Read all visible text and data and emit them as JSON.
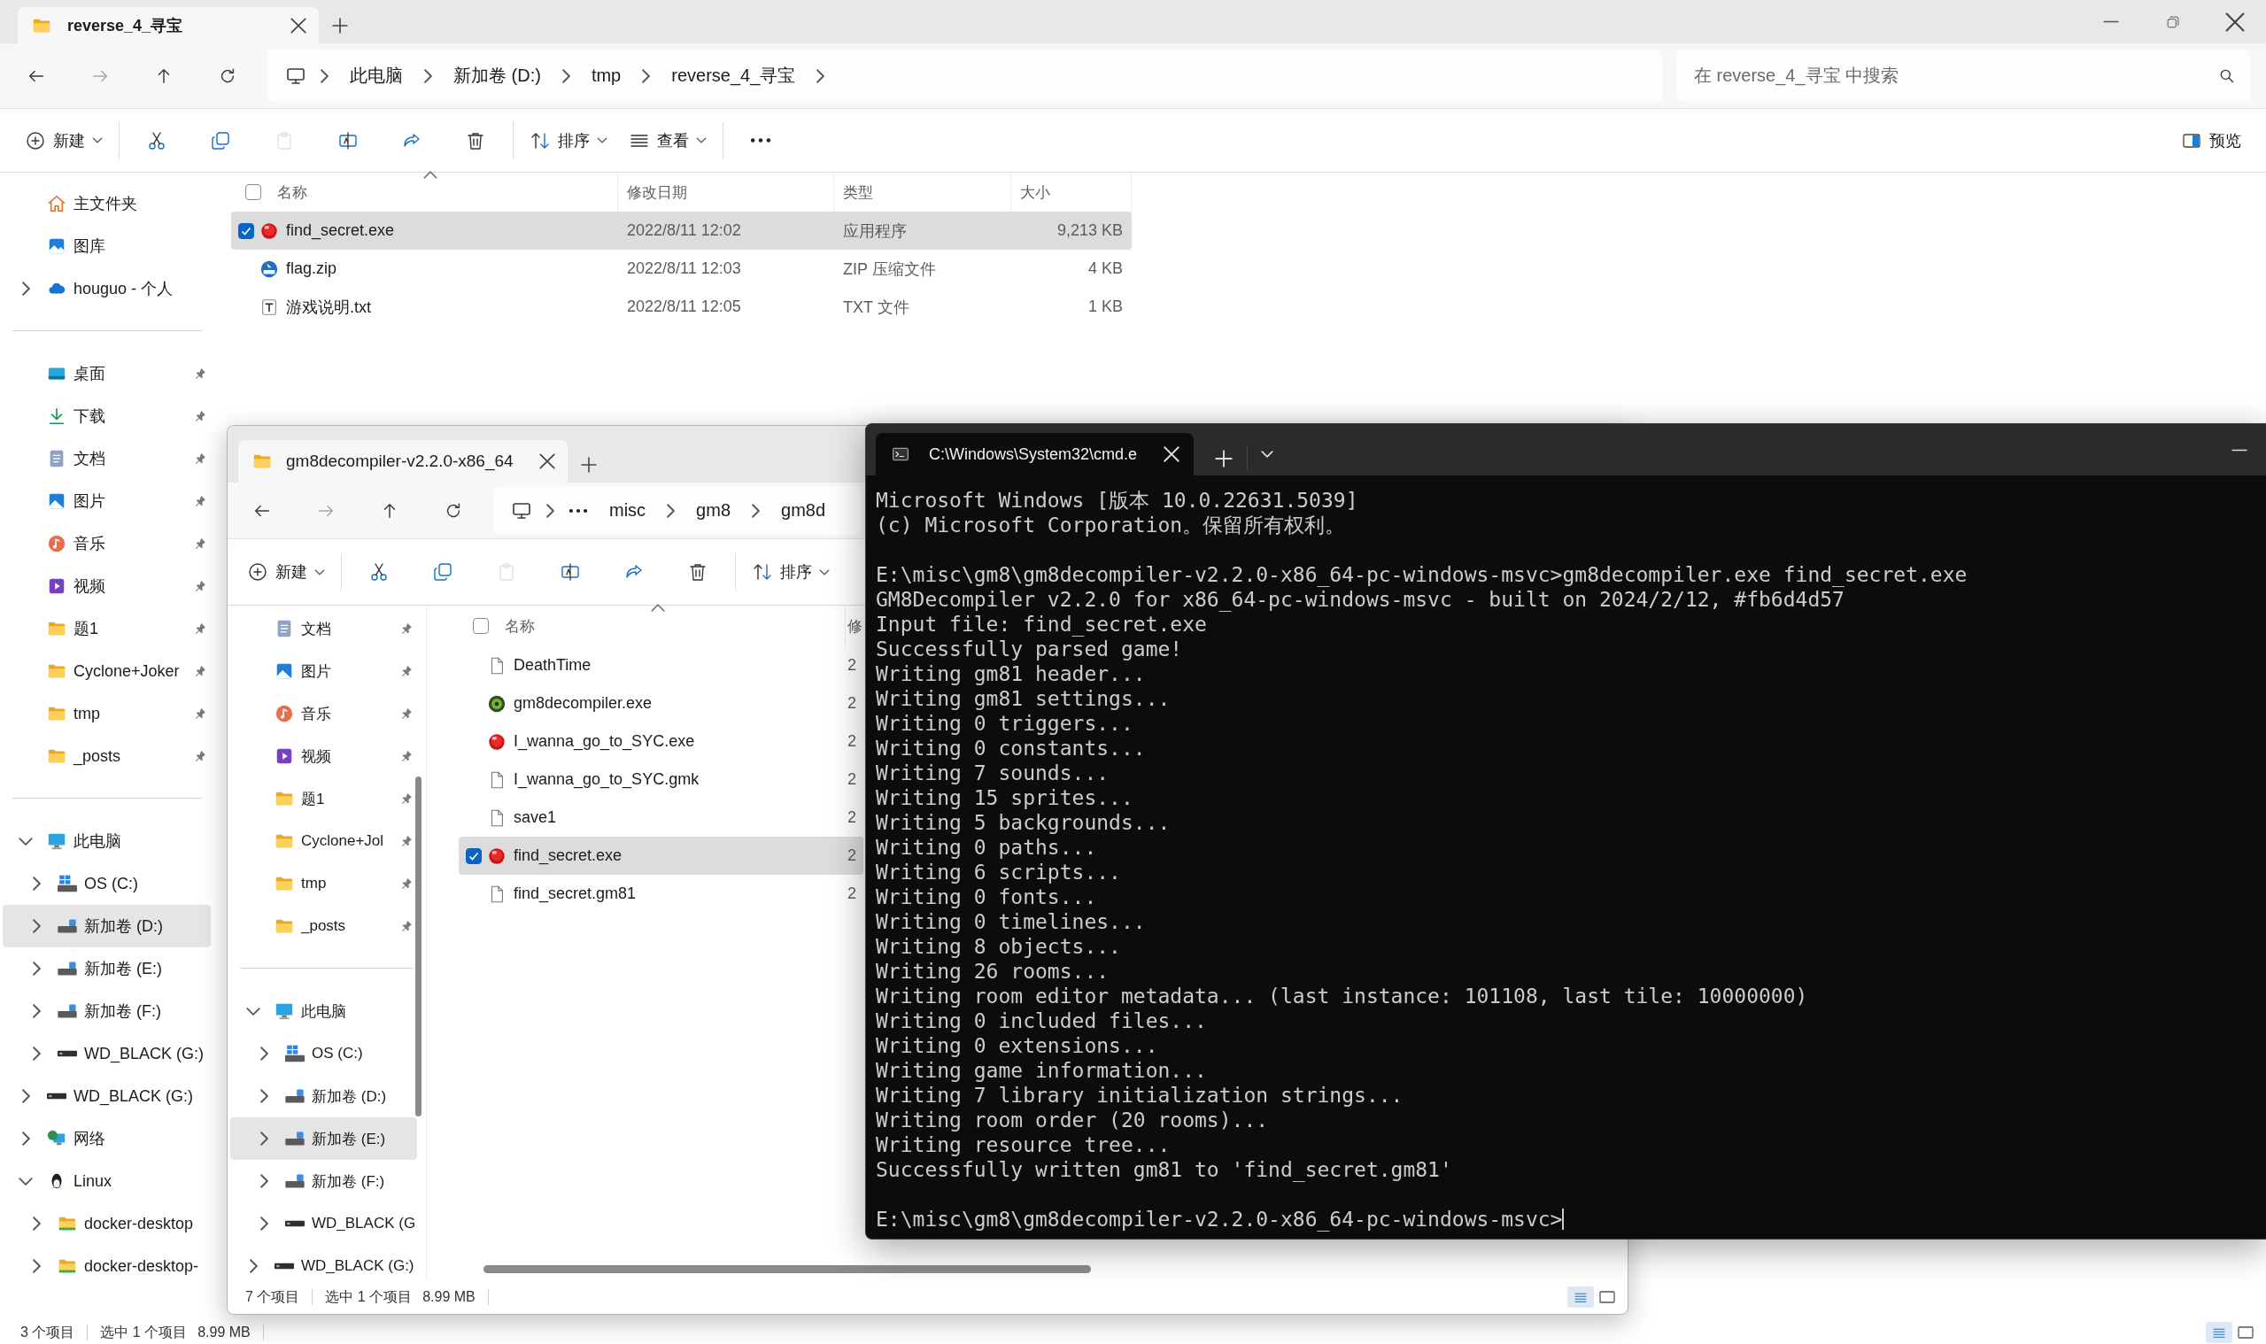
{
  "explorers": [
    {
      "tab": {
        "title": "reverse_4_寻宝"
      },
      "breadcrumb": [
        {
          "kind": "pc"
        },
        {
          "kind": "folder",
          "label": "此电脑"
        },
        {
          "kind": "folder",
          "label": "新加卷 (D:)"
        },
        {
          "kind": "folder",
          "label": "tmp"
        },
        {
          "kind": "folder",
          "label": "reverse_4_寻宝"
        }
      ],
      "search": {
        "placeholder": "在 reverse_4_寻宝 中搜索"
      },
      "toolbar": [
        [
          {
            "kind": "new",
            "label": "新建",
            "disabled": false
          }
        ],
        [
          {
            "kind": "cut",
            "disabled": false
          },
          {
            "kind": "copy",
            "disabled": false
          },
          {
            "kind": "paste",
            "disabled": true
          },
          {
            "kind": "rename",
            "disabled": false
          },
          {
            "kind": "share",
            "disabled": false
          },
          {
            "kind": "delete",
            "disabled": false
          }
        ],
        [
          {
            "kind": "sort",
            "label": "排序",
            "disabled": false
          },
          {
            "kind": "view",
            "label": "查看",
            "disabled": false
          }
        ],
        [
          {
            "kind": "more",
            "disabled": false
          }
        ]
      ],
      "preview": {
        "label": "预览"
      },
      "sidebar": [
        [
          {
            "label": "主文件夹",
            "kind": "home",
            "selected": false
          },
          {
            "label": "图库",
            "kind": "gallery",
            "selected": false
          },
          {
            "label": "houguo - 个人",
            "kind": "cloud",
            "selected": false,
            "expanded": false
          }
        ],
        [
          {
            "label": "桌面",
            "kind": "desktop",
            "selected": false,
            "pinned": true
          },
          {
            "label": "下载",
            "kind": "download",
            "selected": false,
            "pinned": true
          },
          {
            "label": "文档",
            "kind": "docs",
            "selected": false,
            "pinned": true
          },
          {
            "label": "图片",
            "kind": "pictures",
            "selected": false,
            "pinned": true
          },
          {
            "label": "音乐",
            "kind": "music",
            "selected": false,
            "pinned": true
          },
          {
            "label": "视频",
            "kind": "video",
            "selected": false,
            "pinned": true
          },
          {
            "label": "题1",
            "kind": "folder",
            "selected": false,
            "pinned": true
          },
          {
            "label": "Cyclone+Joker",
            "kind": "folder",
            "selected": false,
            "pinned": true
          },
          {
            "label": "tmp",
            "kind": "folder",
            "selected": false,
            "pinned": true
          },
          {
            "label": "_posts",
            "kind": "folder",
            "selected": false,
            "pinned": true
          }
        ],
        [
          {
            "label": "此电脑",
            "kind": "pc",
            "selected": false,
            "expanded": true,
            "children": [
              {
                "label": "OS (C:)",
                "kind": "driveos",
                "selected": false,
                "expanded": false
              },
              {
                "label": "新加卷 (D:)",
                "kind": "drive",
                "selected": true,
                "expanded": false
              },
              {
                "label": "新加卷 (E:)",
                "kind": "drive",
                "selected": false,
                "expanded": false
              },
              {
                "label": "新加卷 (F:)",
                "kind": "drive",
                "selected": false,
                "expanded": false
              },
              {
                "label": "WD_BLACK (G:)",
                "kind": "hdd",
                "selected": false,
                "expanded": false
              }
            ]
          },
          {
            "label": "WD_BLACK (G:)",
            "kind": "hdd",
            "selected": false,
            "expanded": false
          },
          {
            "label": "网络",
            "kind": "network",
            "selected": false,
            "expanded": false
          },
          {
            "label": "Linux",
            "kind": "linux",
            "selected": false,
            "expanded": true,
            "children": [
              {
                "label": "docker-desktop",
                "kind": "folderg",
                "selected": false,
                "expanded": false
              },
              {
                "label": "docker-desktop-",
                "kind": "folderg",
                "selected": false,
                "expanded": false
              }
            ]
          }
        ]
      ],
      "select_all": {
        "checked": false
      },
      "columns": [
        "名称",
        "修改日期",
        "类型",
        "大小"
      ],
      "files": [
        {
          "kind": "redball",
          "cells": [
            "find_secret.exe",
            "2022/8/11 12:02",
            "应用程序",
            "9,213 KB"
          ],
          "selected": true
        },
        {
          "kind": "zip",
          "cells": [
            "flag.zip",
            "2022/8/11 12:03",
            "ZIP 压缩文件",
            "4 KB"
          ],
          "selected": false
        },
        {
          "kind": "txt",
          "cells": [
            "游戏说明.txt",
            "2022/8/11 12:05",
            "TXT 文件",
            "1 KB"
          ],
          "selected": false
        }
      ],
      "status": [
        "3 个项目",
        "选中 1 个项目",
        "8.99 MB"
      ]
    },
    {
      "tab": {
        "title": "gm8decompiler-v2.2.0-x86_64"
      },
      "breadcrumb": [
        {
          "kind": "pc"
        },
        {
          "kind": "overflow"
        },
        {
          "kind": "folder",
          "label": "misc"
        },
        {
          "kind": "folder",
          "label": "gm8"
        },
        {
          "kind": "folder",
          "label": "gm8d"
        }
      ],
      "toolbar": [
        [
          {
            "kind": "new",
            "label": "新建",
            "disabled": false
          }
        ],
        [
          {
            "kind": "cut",
            "disabled": false
          },
          {
            "kind": "copy",
            "disabled": false
          },
          {
            "kind": "paste",
            "disabled": true
          },
          {
            "kind": "rename",
            "disabled": false
          },
          {
            "kind": "share",
            "disabled": false
          },
          {
            "kind": "delete",
            "disabled": false
          }
        ],
        [
          {
            "kind": "sort",
            "label": "排序",
            "disabled": false
          }
        ]
      ],
      "sidebar": [
        [
          {
            "label": "文档",
            "kind": "docs",
            "selected": false,
            "pinned": true
          },
          {
            "label": "图片",
            "kind": "pictures",
            "selected": false,
            "pinned": true
          },
          {
            "label": "音乐",
            "kind": "music",
            "selected": false,
            "pinned": true
          },
          {
            "label": "视频",
            "kind": "video",
            "selected": false,
            "pinned": true
          },
          {
            "label": "题1",
            "kind": "folder",
            "selected": false,
            "pinned": true
          },
          {
            "label": "Cyclone+Jol",
            "kind": "folder",
            "selected": false,
            "pinned": true
          },
          {
            "label": "tmp",
            "kind": "folder",
            "selected": false,
            "pinned": true
          },
          {
            "label": "_posts",
            "kind": "folder",
            "selected": false,
            "pinned": true
          }
        ],
        [
          {
            "label": "此电脑",
            "kind": "pc",
            "selected": false,
            "expanded": true,
            "children": [
              {
                "label": "OS (C:)",
                "kind": "driveos",
                "selected": false,
                "expanded": false
              },
              {
                "label": "新加卷 (D:)",
                "kind": "drive",
                "selected": false,
                "expanded": false
              },
              {
                "label": "新加卷 (E:)",
                "kind": "drive",
                "selected": true,
                "expanded": false
              },
              {
                "label": "新加卷 (F:)",
                "kind": "drive",
                "selected": false,
                "expanded": false
              },
              {
                "label": "WD_BLACK (G",
                "kind": "hdd",
                "selected": false,
                "expanded": false
              }
            ]
          },
          {
            "label": "WD_BLACK (G:)",
            "kind": "hdd",
            "selected": false,
            "expanded": false
          }
        ]
      ],
      "select_all": {
        "checked": false
      },
      "columns": [
        "名称",
        "修"
      ],
      "files": [
        {
          "kind": "file",
          "cells": [
            "DeathTime",
            "2"
          ],
          "selected": false
        },
        {
          "kind": "gear",
          "cells": [
            "gm8decompiler.exe",
            "2"
          ],
          "selected": false
        },
        {
          "kind": "redball",
          "cells": [
            "I_wanna_go_to_SYC.exe",
            "2"
          ],
          "selected": false
        },
        {
          "kind": "file",
          "cells": [
            "I_wanna_go_to_SYC.gmk",
            "2"
          ],
          "selected": false
        },
        {
          "kind": "file",
          "cells": [
            "save1",
            "2"
          ],
          "selected": false
        },
        {
          "kind": "redball",
          "cells": [
            "find_secret.exe",
            "2"
          ],
          "selected": true
        },
        {
          "kind": "file",
          "cells": [
            "find_secret.gm81",
            "2"
          ],
          "selected": false
        }
      ],
      "status": [
        "7 个项目",
        "选中 1 个项目",
        "8.99 MB"
      ]
    }
  ],
  "terminal": {
    "tab": {
      "title": "C:\\Windows\\System32\\cmd.e"
    },
    "blocks": [
      {
        "lines": [
          "Microsoft Windows [版本 10.0.22631.5039]",
          "(c) Microsoft Corporation。保留所有权利。"
        ],
        "cursor": false
      },
      {
        "lines": [
          "E:\\misc\\gm8\\gm8decompiler-v2.2.0-x86_64-pc-windows-msvc>gm8decompiler.exe find_secret.exe",
          "GM8Decompiler v2.2.0 for x86_64-pc-windows-msvc - built on 2024/2/12, #fb6d4d57",
          "Input file: find_secret.exe",
          "Successfully parsed game!",
          "Writing gm81 header...",
          "Writing gm81 settings...",
          "Writing 0 triggers...",
          "Writing 0 constants...",
          "Writing 7 sounds...",
          "Writing 15 sprites...",
          "Writing 5 backgrounds...",
          "Writing 0 paths...",
          "Writing 6 scripts...",
          "Writing 0 fonts...",
          "Writing 0 timelines...",
          "Writing 8 objects...",
          "Writing 26 rooms...",
          "Writing room editor metadata... (last instance: 101108, last tile: 10000000)",
          "Writing 0 included files...",
          "Writing 0 extensions...",
          "Writing game information...",
          "Writing 7 library initialization strings...",
          "Writing room order (20 rooms)...",
          "Writing resource tree...",
          "Successfully written gm81 to 'find_secret.gm81'"
        ],
        "cursor": false
      },
      {
        "lines": [
          "E:\\misc\\gm8\\gm8decompiler-v2.2.0-x86_64-pc-windows-msvc>"
        ],
        "cursor": true
      }
    ]
  }
}
